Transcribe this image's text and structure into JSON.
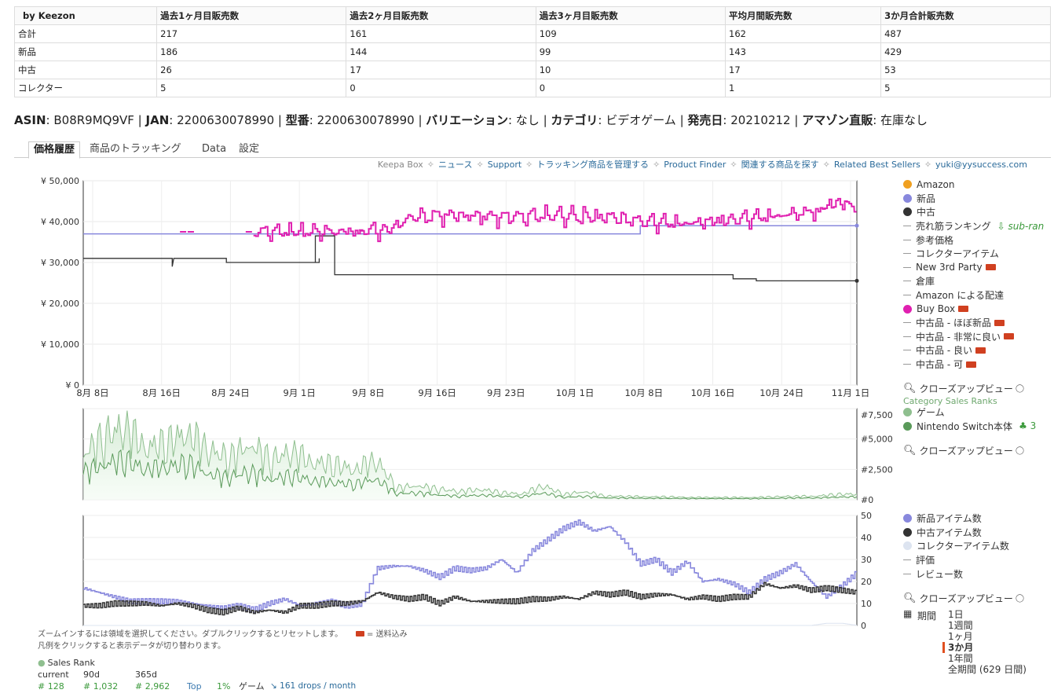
{
  "stats": {
    "headers": [
      "by Keezon",
      "過去1ヶ月目販売数",
      "過去2ヶ月目販売数",
      "過去3ヶ月目販売数",
      "平均月間販売数",
      "3か月合計販売数"
    ],
    "rows": [
      [
        "合計",
        "217",
        "161",
        "109",
        "162",
        "487"
      ],
      [
        "新品",
        "186",
        "144",
        "99",
        "143",
        "429"
      ],
      [
        "中古",
        "26",
        "17",
        "10",
        "17",
        "53"
      ],
      [
        "コレクター",
        "5",
        "0",
        "0",
        "1",
        "5"
      ]
    ]
  },
  "info": {
    "asin_label": "ASIN",
    "asin": "B08R9MQ9VF",
    "jan_label": "JAN",
    "jan": "2200630078990",
    "model_label": "型番",
    "model": "2200630078990",
    "variation_label": "バリエーション",
    "variation": "なし",
    "category_label": "カテゴリ",
    "category": "ビデオゲーム",
    "release_label": "発売日",
    "release": "20210212",
    "amazon_label": "アマゾン直販",
    "amazon": "在庫なし"
  },
  "tabs": [
    "価格履歴",
    "商品のトラッキング",
    "Data",
    "設定"
  ],
  "links": [
    "Keepa Box",
    "ニュース",
    "Support",
    "トラッキング商品を管理する",
    "Product Finder",
    "関連する商品を探す",
    "Related Best Sellers",
    "yuki@yysuccess.com"
  ],
  "legend_price": [
    {
      "label": "Amazon",
      "type": "dot",
      "color": "#f0a020"
    },
    {
      "label": "新品",
      "type": "dot",
      "color": "#8888dd"
    },
    {
      "label": "中古",
      "type": "dot",
      "color": "#333333"
    },
    {
      "label": "売れ筋ランキング",
      "type": "dash",
      "extra": "sub-ran"
    },
    {
      "label": "参考価格",
      "type": "dash"
    },
    {
      "label": "コレクターアイテム",
      "type": "dash"
    },
    {
      "label": "New 3rd Party",
      "type": "dash",
      "truck": true
    },
    {
      "label": "倉庫",
      "type": "dash"
    },
    {
      "label": "Amazon による配達",
      "type": "dash"
    },
    {
      "label": "Buy Box",
      "type": "dot",
      "color": "#e020b0",
      "truck": true
    },
    {
      "label": "中古品 - ほぼ新品",
      "type": "dash",
      "truck": true
    },
    {
      "label": "中古品 - 非常に良い",
      "type": "dash",
      "truck": true
    },
    {
      "label": "中古品 - 良い",
      "type": "dash",
      "truck": true
    },
    {
      "label": "中古品 - 可",
      "type": "dash",
      "truck": true
    }
  ],
  "closeup_label": "クローズアップビュー",
  "category_sales_ranks": "Category Sales Ranks",
  "legend_rank": [
    {
      "label": "ゲーム",
      "color": "#8fbf8f"
    },
    {
      "label": "Nintendo Switch本体",
      "color": "#5a9a5a",
      "extra": "3"
    }
  ],
  "legend_count": [
    {
      "label": "新品アイテム数",
      "type": "dot",
      "color": "#8888dd"
    },
    {
      "label": "中古アイテム数",
      "type": "dot",
      "color": "#333333"
    },
    {
      "label": "コレクターアイテム数",
      "type": "dot",
      "color": "#dde4f0"
    },
    {
      "label": "評価",
      "type": "dash"
    },
    {
      "label": "レビュー数",
      "type": "dash"
    }
  ],
  "period": {
    "label": "期間",
    "options": [
      "1日",
      "1週間",
      "1ヶ月",
      "3か月",
      "1年間",
      "全期間 (629 日間)"
    ],
    "selected": "3か月"
  },
  "footer": {
    "line1": "ズームインするには領域を選択してください。ダブルクリックするとリセットします。",
    "truck_note": "= 送料込み",
    "line2": "凡例をクリックすると表示データが切り替わります。"
  },
  "sales_rank": {
    "title": "Sales Rank",
    "headers": [
      "current",
      "90d",
      "365d"
    ],
    "values": [
      "# 128",
      "# 1,032",
      "# 2,962"
    ],
    "top_label": "Top",
    "top_value": "1%",
    "category": "ゲーム",
    "drops": "161 drops / month"
  },
  "chart_data": [
    {
      "type": "line",
      "title": "",
      "y_ticks": [
        "¥ 0",
        "¥ 10,000",
        "¥ 20,000",
        "¥ 30,000",
        "¥ 40,000",
        "¥ 50,000"
      ],
      "ylim": [
        0,
        50000
      ],
      "x_ticks": [
        "8月 8日",
        "8月 16日",
        "8月 24日",
        "9月 1日",
        "9月 8日",
        "9月 16日",
        "9月 23日",
        "10月 1日",
        "10月 8日",
        "10月 16日",
        "10月 24日",
        "11月 1日"
      ],
      "series": [
        {
          "name": "新品",
          "color": "#8888dd",
          "points": [
            [
              0,
              37000
            ],
            [
              0.72,
              37000
            ],
            [
              0.72,
              39000
            ],
            [
              1,
              39000
            ]
          ]
        },
        {
          "name": "中古",
          "color": "#333333",
          "points": [
            [
              0,
              31000
            ],
            [
              0.115,
              31000
            ],
            [
              0.115,
              29000
            ],
            [
              0.117,
              31000
            ],
            [
              0.185,
              31000
            ],
            [
              0.185,
              30000
            ],
            [
              0.305,
              30000
            ],
            [
              0.305,
              31000
            ],
            [
              0.305,
              30000
            ],
            [
              0.3,
              30000
            ],
            [
              0.3,
              36500
            ],
            [
              0.325,
              36500
            ],
            [
              0.325,
              27000
            ],
            [
              0.84,
              27000
            ],
            [
              0.84,
              26000
            ],
            [
              0.87,
              26000
            ],
            [
              0.87,
              25500
            ],
            [
              1,
              25500
            ]
          ]
        },
        {
          "name": "Buy Box",
          "color": "#e020b0",
          "points": [
            [
              0.125,
              37500
            ],
            [
              0.135,
              37500
            ],
            [
              0.21,
              37500
            ],
            [
              0.22,
              37500
            ],
            [
              0.355,
              37500
            ],
            [
              0.36,
              37800
            ],
            [
              0.39,
              38000
            ],
            [
              0.41,
              39000
            ],
            [
              0.42,
              41000
            ],
            [
              0.47,
              41500
            ],
            [
              0.55,
              41000
            ],
            [
              0.6,
              41500
            ],
            [
              0.68,
              41000
            ],
            [
              0.72,
              40000
            ],
            [
              0.78,
              39500
            ],
            [
              0.84,
              40500
            ],
            [
              0.9,
              41500
            ],
            [
              0.95,
              42500
            ],
            [
              0.97,
              44500
            ],
            [
              0.99,
              44000
            ],
            [
              1,
              43000
            ]
          ]
        }
      ]
    },
    {
      "type": "area",
      "title": "",
      "y_ticks": [
        "#0",
        "#2,500",
        "#5,000",
        "#7,500"
      ],
      "ylim": [
        0,
        7500
      ],
      "series": [
        {
          "name": "ゲーム",
          "color": "#8fbf8f",
          "values": [
            3800,
            5400,
            6200,
            4500,
            4800,
            5800,
            4200,
            3600,
            4700,
            3400,
            4100,
            3200,
            3000,
            2600,
            3400,
            1000,
            1200,
            900,
            700,
            900,
            600,
            500,
            1200,
            450,
            700,
            300,
            300,
            250,
            250,
            200,
            200,
            200,
            200,
            250,
            300,
            300,
            450,
            500
          ]
        },
        {
          "name": "Nintendo Switch本体",
          "color": "#5a9a5a",
          "values": [
            2400,
            3000,
            3400,
            2600,
            2800,
            3100,
            2200,
            1900,
            2400,
            1700,
            2100,
            1600,
            1500,
            1300,
            1800,
            500,
            600,
            400,
            300,
            400,
            300,
            250,
            600,
            200,
            300,
            150,
            150,
            120,
            120,
            100,
            100,
            100,
            100,
            120,
            150,
            150,
            220,
            250
          ]
        }
      ]
    },
    {
      "type": "line",
      "title": "",
      "y_ticks": [
        "0",
        "10",
        "20",
        "30",
        "40",
        "50"
      ],
      "ylim": [
        0,
        50
      ],
      "series": [
        {
          "name": "新品アイテム数",
          "color": "#8888dd",
          "values": [
            17,
            15,
            13,
            11,
            11,
            11,
            11,
            10,
            9,
            8,
            9,
            7,
            10,
            12,
            9,
            10,
            11,
            9,
            10,
            26,
            27,
            27,
            25,
            22,
            26,
            25,
            26,
            30,
            24,
            34,
            39,
            44,
            47,
            43,
            45,
            38,
            28,
            30,
            24,
            29,
            20,
            21,
            19,
            15,
            21,
            24,
            28,
            20,
            13,
            18,
            24
          ]
        },
        {
          "name": "中古アイテム数",
          "color": "#333333",
          "values": [
            9,
            9,
            10,
            10,
            10,
            9,
            10,
            9,
            7,
            6,
            8,
            6,
            7,
            6,
            9,
            9,
            10,
            10,
            11,
            15,
            13,
            12,
            13,
            10,
            13,
            11,
            11,
            11,
            11,
            12,
            12,
            13,
            12,
            15,
            14,
            15,
            13,
            14,
            14,
            12,
            13,
            12,
            13,
            13,
            19,
            17,
            18,
            16,
            17,
            16,
            15
          ]
        },
        {
          "name": "コレクターアイテム数",
          "color": "#dde4f0",
          "values": [
            0,
            0,
            0,
            0,
            0,
            0,
            0,
            0,
            0,
            0,
            0,
            0,
            0,
            0,
            0,
            0,
            0,
            0,
            0,
            0,
            0,
            0,
            0,
            0,
            0,
            0,
            0,
            0,
            0,
            0,
            0,
            0,
            0,
            0,
            0,
            0,
            0,
            0,
            0,
            0,
            0,
            0,
            0,
            0,
            0,
            0,
            0,
            0,
            1,
            1,
            0
          ]
        }
      ]
    }
  ]
}
